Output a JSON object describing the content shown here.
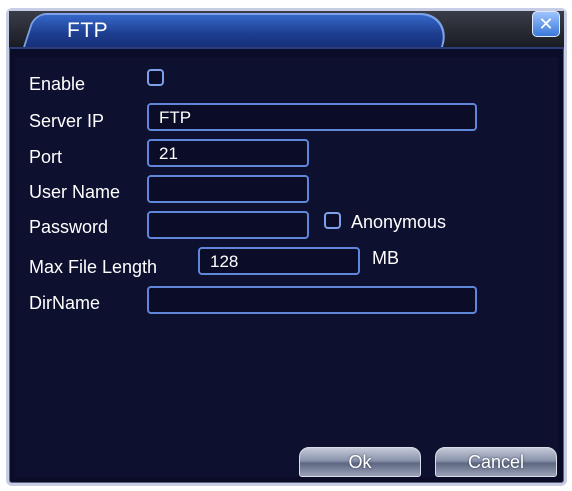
{
  "dialog": {
    "title": "FTP",
    "close_glyph": "✕"
  },
  "form": {
    "enable_label": "Enable",
    "enable_checked": false,
    "server_ip_label": "Server IP",
    "server_ip_value": "FTP",
    "port_label": "Port",
    "port_value": "21",
    "user_name_label": "User Name",
    "user_name_value": "",
    "password_label": "Password",
    "password_value": "",
    "anonymous_label": "Anonymous",
    "anonymous_checked": false,
    "max_file_length_label": "Max File Length",
    "max_file_length_value": "128",
    "max_file_length_unit": "MB",
    "dirname_label": "DirName",
    "dirname_value": ""
  },
  "buttons": {
    "ok_label": "Ok",
    "cancel_label": "Cancel"
  },
  "icons": {
    "close": "close-icon",
    "checkbox": "checkbox-icon"
  },
  "colors": {
    "background": "#0e1030",
    "title_tab": "#1d3d8f",
    "field_border": "#5f86d8",
    "text": "#ffffff"
  }
}
